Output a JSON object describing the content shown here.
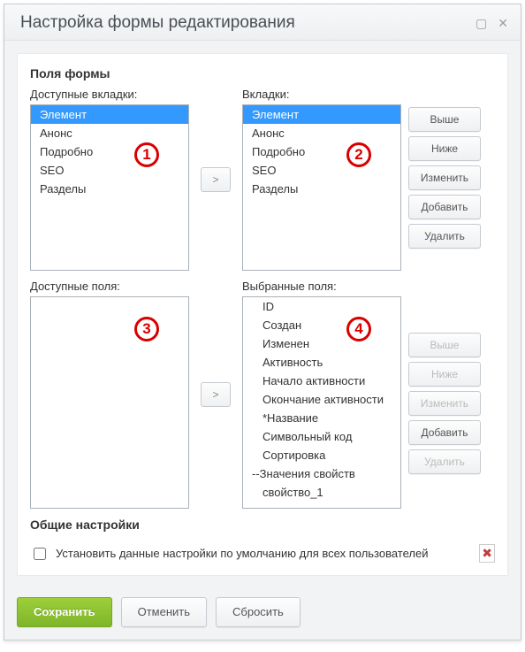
{
  "dialog": {
    "title": "Настройка формы редактирования"
  },
  "sections": {
    "form_fields": "Поля формы",
    "general": "Общие настройки"
  },
  "labels": {
    "available_tabs": "Доступные вкладки:",
    "tabs": "Вкладки:",
    "available_fields": "Доступные поля:",
    "selected_fields": "Выбранные поля:"
  },
  "lists": {
    "available_tabs": [
      {
        "label": "Элемент",
        "selected": true
      },
      {
        "label": "Анонс"
      },
      {
        "label": "Подробно"
      },
      {
        "label": "SEO"
      },
      {
        "label": "Разделы"
      }
    ],
    "tabs": [
      {
        "label": "Элемент",
        "selected": true
      },
      {
        "label": "Анонс"
      },
      {
        "label": "Подробно"
      },
      {
        "label": "SEO"
      },
      {
        "label": "Разделы"
      }
    ],
    "available_fields": [],
    "selected_fields": [
      {
        "label": "ID",
        "indent": 1
      },
      {
        "label": "Создан",
        "indent": 1
      },
      {
        "label": "Изменен",
        "indent": 1
      },
      {
        "label": "Активность",
        "indent": 1
      },
      {
        "label": "Начало активности",
        "indent": 1
      },
      {
        "label": "Окончание активности",
        "indent": 1
      },
      {
        "label": "*Название",
        "indent": 1
      },
      {
        "label": "Символьный код",
        "indent": 1
      },
      {
        "label": "Сортировка",
        "indent": 1
      },
      {
        "label": "--Значения свойств",
        "indent": 0
      },
      {
        "label": "свойство_1",
        "indent": 1
      }
    ]
  },
  "buttons": {
    "up": "Выше",
    "down": "Ниже",
    "edit": "Изменить",
    "add": "Добавить",
    "delete": "Удалить",
    "arrow": ">",
    "save": "Сохранить",
    "cancel": "Отменить",
    "reset": "Сбросить"
  },
  "general_checkbox": {
    "label": "Установить данные настройки по умолчанию для всех пользователей",
    "checked": false
  },
  "annotations": {
    "a1": "1",
    "a2": "2",
    "a3": "3",
    "a4": "4"
  }
}
